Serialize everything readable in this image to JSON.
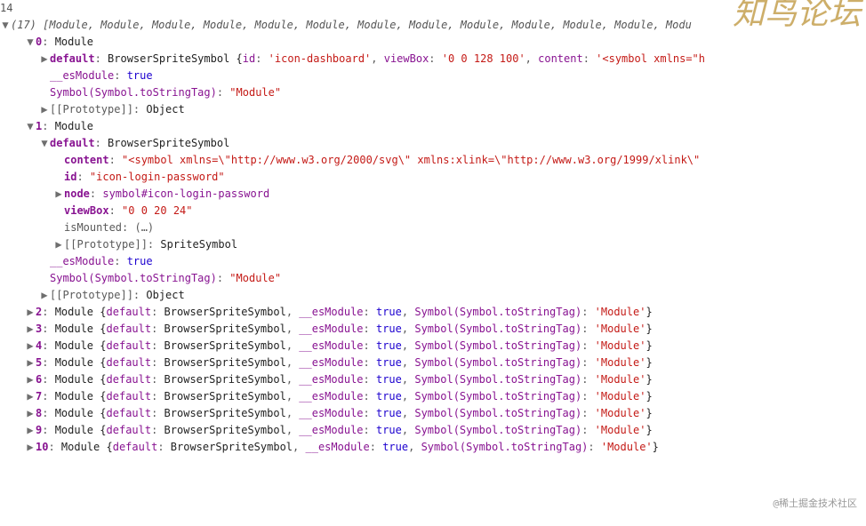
{
  "watermark_top": "知鸟论坛",
  "watermark_bottom": "@稀土掘金技术社区",
  "line_no": "14",
  "array_header": {
    "length": "(17)",
    "items_preview": "[Module, Module, Module, Module, Module, Module, Module, Module, Module, Module, Module, Module, Modu"
  },
  "item0": {
    "index": "0",
    "type": "Module",
    "default_label": "default",
    "default_class": "BrowserSpriteSymbol",
    "id_key": "id",
    "id_val": "'icon-dashboard'",
    "viewBox_key": "viewBox",
    "viewBox_val": "'0 0 128 100'",
    "content_key": "content",
    "content_val": "'<symbol xmlns=\"h",
    "esModule_key": "__esModule",
    "esModule_val": "true",
    "symbolTag_key": "Symbol(Symbol.toStringTag)",
    "symbolTag_val": "\"Module\"",
    "proto_key": "[[Prototype]]",
    "proto_val": "Object"
  },
  "item1": {
    "index": "1",
    "type": "Module",
    "default_label": "default",
    "default_class": "BrowserSpriteSymbol",
    "content_key": "content",
    "content_val": "\"<symbol xmlns=\\\"http://www.w3.org/2000/svg\\\" xmlns:xlink=\\\"http://www.w3.org/1999/xlink\\\"",
    "id_key": "id",
    "id_val": "\"icon-login-password\"",
    "node_key": "node",
    "node_val": "symbol#icon-login-password",
    "viewBox_key": "viewBox",
    "viewBox_val": "\"0 0 20 24\"",
    "isMounted_key": "isMounted",
    "isMounted_val": "(…)",
    "proto1_key": "[[Prototype]]",
    "proto1_val": "SpriteSymbol",
    "esModule_key": "__esModule",
    "esModule_val": "true",
    "symbolTag_key": "Symbol(Symbol.toStringTag)",
    "symbolTag_val": "\"Module\"",
    "proto2_key": "[[Prototype]]",
    "proto2_val": "Object"
  },
  "collapsed": {
    "type": "Module",
    "open": "{default:",
    "class": "BrowserSpriteSymbol",
    "es_key": "__esModule",
    "es_val": "true",
    "sym_key": "Symbol(Symbol.toStringTag)",
    "sym_val": "'Module'",
    "close": "}",
    "items": [
      {
        "i": "2"
      },
      {
        "i": "3"
      },
      {
        "i": "4"
      },
      {
        "i": "5"
      },
      {
        "i": "6"
      },
      {
        "i": "7"
      },
      {
        "i": "8"
      },
      {
        "i": "9"
      },
      {
        "i": "10"
      }
    ]
  }
}
